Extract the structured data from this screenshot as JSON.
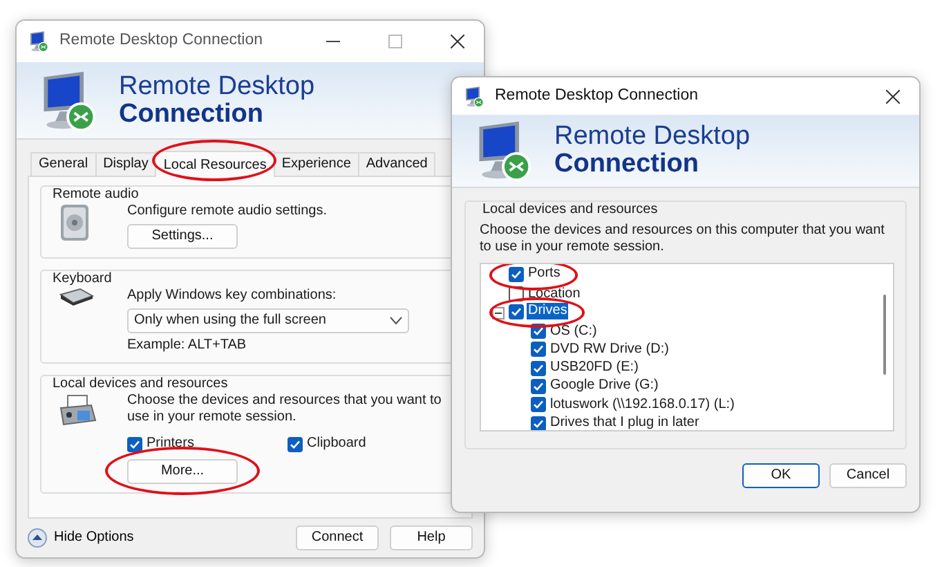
{
  "main_window": {
    "title": "Remote Desktop Connection",
    "banner": {
      "line_1": "Remote Desktop",
      "line_2": "Connection"
    },
    "tabs": [
      {
        "label": "General",
        "selected": false,
        "circled": false
      },
      {
        "label": "Display",
        "selected": false,
        "circled": false
      },
      {
        "label": "Local Resources",
        "selected": true,
        "circled": true
      },
      {
        "label": "Experience",
        "selected": false,
        "circled": false
      },
      {
        "label": "Advanced",
        "selected": false,
        "circled": false
      }
    ],
    "remote_audio": {
      "heading": "Remote audio",
      "description": "Configure remote audio settings.",
      "button": {
        "label": "Settings..."
      }
    },
    "keyboard": {
      "heading": "Keyboard",
      "label": "Apply Windows key combinations:",
      "dropdown": {
        "value": "Only when using the full screen"
      },
      "example": "Example: ALT+TAB"
    },
    "local_devices": {
      "heading": "Local devices and resources",
      "description": "Choose the devices and resources that you want to use in your remote session.",
      "checkboxes": [
        {
          "label": "Printers",
          "checked": true
        },
        {
          "label": "Clipboard",
          "checked": true
        }
      ],
      "button": {
        "label": "More...",
        "circled": true
      }
    },
    "footer": {
      "hide_options": "Hide Options",
      "buttons": [
        "Connect",
        "Help"
      ]
    }
  },
  "dialog": {
    "title": "Remote Desktop Connection",
    "banner": {
      "line_1": "Remote Desktop",
      "line_2": "Connection"
    },
    "group": {
      "heading": "Local devices and resources",
      "description": "Choose the devices and resources on this computer that you want to use in your remote session.",
      "tree": [
        {
          "label": "Ports",
          "checked": true,
          "selected": false,
          "circled": true
        },
        {
          "label": "Location",
          "checked": false,
          "selected": false,
          "circled": false
        },
        {
          "label": "Drives",
          "checked": true,
          "selected": true,
          "circled": true,
          "expanded": true,
          "children": [
            {
              "label": "OS (C:)",
              "checked": true,
              "selected": false,
              "circled": false
            },
            {
              "label": "DVD RW Drive (D:)",
              "checked": true,
              "selected": false,
              "circled": false
            },
            {
              "label": "USB20FD (E:)",
              "checked": true,
              "selected": false,
              "circled": false
            },
            {
              "label": "Google Drive (G:)",
              "checked": true,
              "selected": false,
              "circled": false
            },
            {
              "label": "lotuswork (\\\\192.168.0.17) (L:)",
              "checked": true,
              "selected": false,
              "circled": false
            },
            {
              "label": "Drives that I plug in later",
              "checked": true,
              "selected": false,
              "circled": false
            }
          ]
        }
      ]
    },
    "buttons": [
      {
        "label": "OK",
        "default": true
      },
      {
        "label": "Cancel",
        "default": false
      }
    ]
  }
}
